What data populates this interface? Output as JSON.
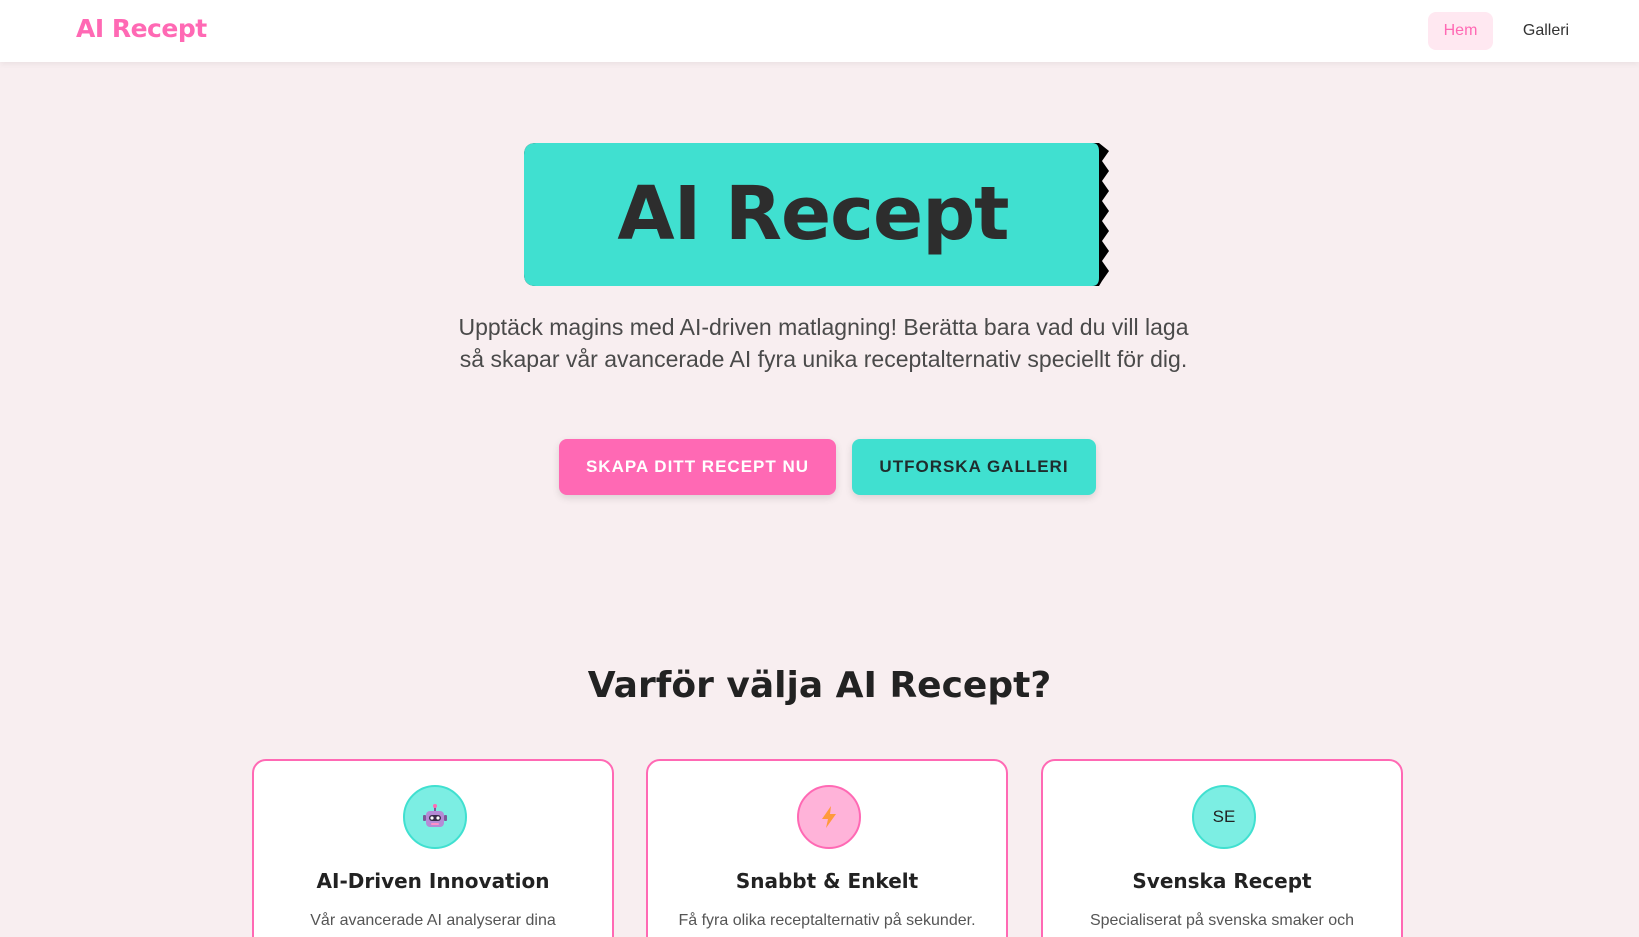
{
  "nav": {
    "brand": "AI Recept",
    "links": [
      {
        "label": "Hem",
        "active": true
      },
      {
        "label": "Galleri",
        "active": false
      }
    ]
  },
  "hero": {
    "title": "AI Recept",
    "subtitle": "Upptäck magins med AI-driven matlagning! Berätta bara vad du vill laga så skapar vår avancerade AI fyra unika receptalternativ speciellt för dig.",
    "primary_button": "SKAPA DITT RECEPT NU",
    "secondary_button": "UTFORSKA GALLERI"
  },
  "features": {
    "title": "Varför välja AI Recept?",
    "cards": [
      {
        "icon": "robot-icon",
        "title": "AI-Driven Innovation",
        "text": "Vår avancerade AI analyserar dina önskemål och skapar unika recept"
      },
      {
        "icon": "lightning-icon",
        "title": "Snabbt & Enkelt",
        "text": "Få fyra olika receptalternativ på sekunder. Ange vad du vill laga och vi gör resten"
      },
      {
        "icon": "se-badge",
        "icon_text": "SE",
        "title": "Svenska Recept",
        "text": "Specialiserat på svenska smaker och ingredienser som finns tillgängliga lokalt"
      }
    ]
  },
  "colors": {
    "accent_pink": "#ff69b4",
    "accent_teal": "#40e0d0",
    "background": "#f8eef0"
  }
}
